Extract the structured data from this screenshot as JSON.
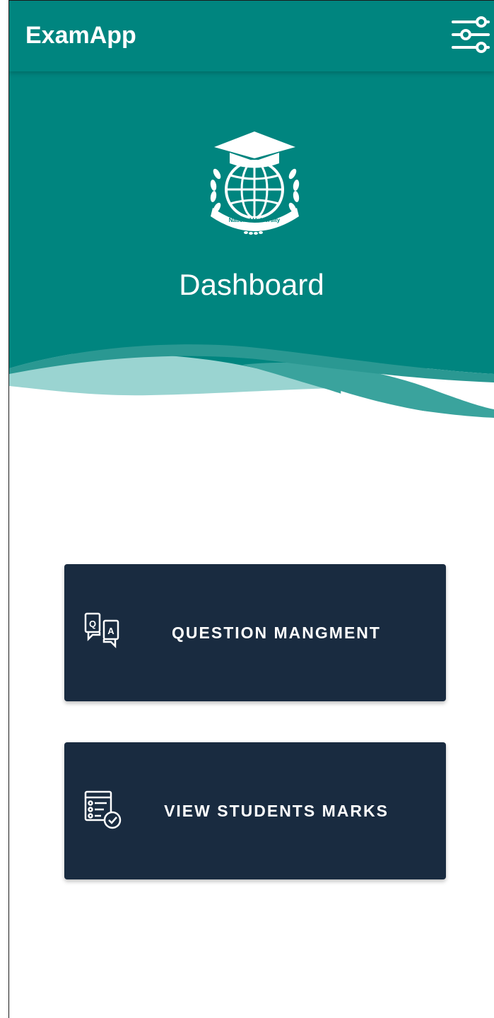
{
  "app_bar": {
    "title": "ExamApp",
    "filter_icon": "sliders-icon",
    "color": "#00857f"
  },
  "hero": {
    "logo_icon": "national-university-logo",
    "logo_text": "National University",
    "title": "Dashboard",
    "colors": {
      "primary": "#00857f",
      "wave_mid": "#3aa39d",
      "wave_light": "#9ad4d1"
    }
  },
  "cards": {
    "question_management": {
      "label": "QUESTION MANGMENT",
      "icon": "question-answer-icon"
    },
    "view_marks": {
      "label": "VIEW STUDENTS MARKS",
      "icon": "marks-report-icon"
    },
    "color": "#192b40"
  }
}
